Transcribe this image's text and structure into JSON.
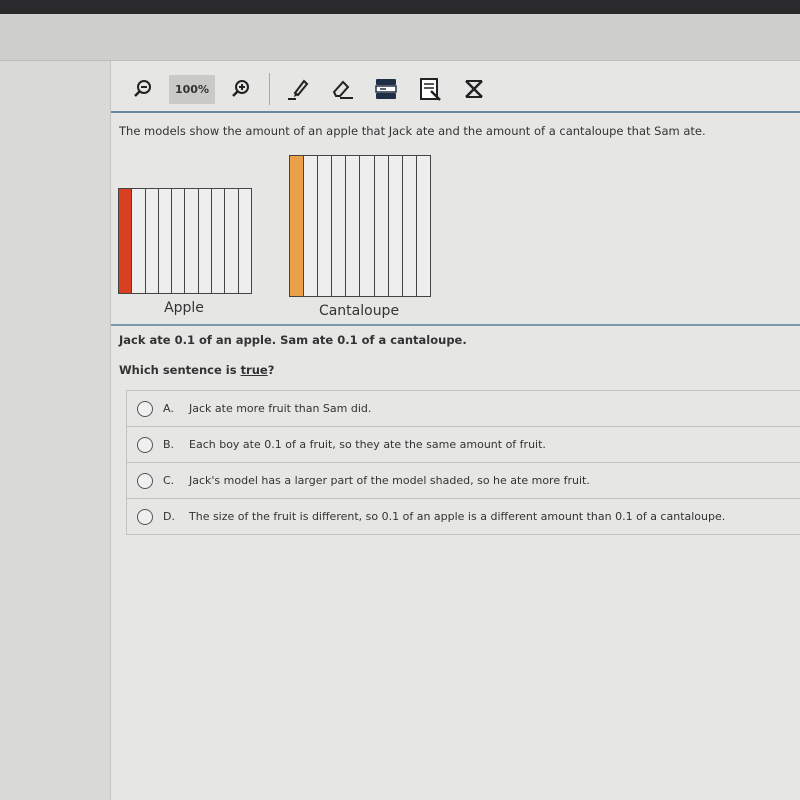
{
  "toolbar": {
    "zoom_level": "100%",
    "tools": [
      "zoom-out-icon",
      "zoom-in-icon",
      "highlighter-icon",
      "eraser-icon",
      "line-reader-icon",
      "notepad-icon",
      "answer-eliminator-icon"
    ]
  },
  "question": {
    "intro": "The models show the amount of an apple that Jack ate and the amount of a cantaloupe that Sam ate.",
    "models": [
      {
        "label": "Apple",
        "parts": 10,
        "shaded": 1,
        "color": "#d8401f"
      },
      {
        "label": "Cantaloupe",
        "parts": 10,
        "shaded": 1,
        "color": "#e9a048"
      }
    ],
    "statement": "Jack ate 0.1 of an apple. Sam ate 0.1 of a cantaloupe.",
    "prompt_before": "Which sentence is ",
    "prompt_emph": "true",
    "prompt_after": "?",
    "options": [
      {
        "letter": "A.",
        "text": "Jack ate more fruit than Sam did."
      },
      {
        "letter": "B.",
        "text": "Each boy ate 0.1 of a fruit, so they ate the same amount of fruit."
      },
      {
        "letter": "C.",
        "text": "Jack's model has a larger part of the model shaded, so he ate more fruit."
      },
      {
        "letter": "D.",
        "text": "The size of the fruit is different, so 0.1 of an apple is a different amount than 0.1 of a cantaloupe."
      }
    ]
  }
}
